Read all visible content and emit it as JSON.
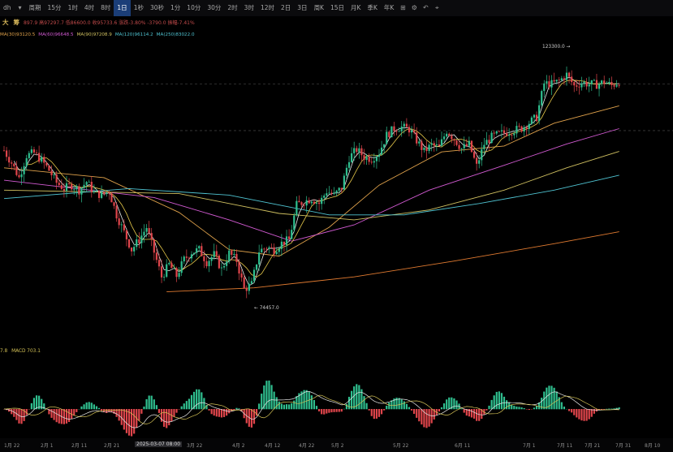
{
  "toolbar": {
    "symbol": "dh",
    "period_label": "周期",
    "intervals": [
      "15分",
      "1时",
      "4时",
      "8时",
      "1日",
      "1秒",
      "30秒",
      "1分",
      "10分",
      "30分",
      "2时",
      "3时",
      "12时",
      "2日",
      "3日",
      "周K",
      "15日",
      "月K",
      "季K",
      "年K"
    ],
    "active_interval": "1日"
  },
  "drawing": {
    "buttons": [
      "大",
      "筹"
    ],
    "ohlc_text": "897.9  高97297.7  低86600.0  收95733.6  涨跌-3.80%  -3790.0  振幅-7.41%"
  },
  "ma_legend": [
    {
      "label": "MA(30)93120.5",
      "color": "#e0a24b"
    },
    {
      "label": "MA(60)96648.5",
      "color": "#d25ad2"
    },
    {
      "label": "MA(90)97208.9",
      "color": "#d0c060"
    },
    {
      "label": "MA(120)96114.2",
      "color": "#4fc3d1"
    },
    {
      "label": "MA(250)83022.0",
      "color": "#4fc3d1"
    }
  ],
  "price_annotations": {
    "high": "123300.0",
    "low": "74457.0"
  },
  "macd": {
    "label_prefix": "7.8",
    "label": "MACD 703.1"
  },
  "xaxis": {
    "labels": [
      "1月 22",
      "2月 1",
      "2月 11",
      "2月 21",
      "2025-03-07 08:00",
      "3月 22",
      "4月 2",
      "4月 12",
      "4月 22",
      "5月 2",
      "5月 22",
      "6月 11",
      "7月 1",
      "7月 11",
      "7月 21",
      "7月 31",
      "8月 10"
    ],
    "highlighted": "2025-03-07 08:00"
  },
  "chart_data": {
    "type": "candlestick",
    "title": "",
    "x_start": "2025-01-17",
    "x_end": "2025-07-31",
    "visible_price_extremes": {
      "high": 123300.0,
      "low": 74457.0
    },
    "moving_averages": [
      "MA(30)",
      "MA(60)",
      "MA(90)",
      "MA(120)",
      "MA(250)"
    ],
    "grid": false,
    "close_path": [
      [
        0,
        104500
      ],
      [
        3,
        102000
      ],
      [
        6,
        99000
      ],
      [
        9,
        103500
      ],
      [
        12,
        104000
      ],
      [
        15,
        102500
      ],
      [
        18,
        100500
      ],
      [
        21,
        98000
      ],
      [
        24,
        96800
      ],
      [
        27,
        97500
      ],
      [
        30,
        96500
      ],
      [
        33,
        98200
      ],
      [
        36,
        96000
      ],
      [
        39,
        95500
      ],
      [
        42,
        96300
      ],
      [
        45,
        91500
      ],
      [
        48,
        88000
      ],
      [
        51,
        84500
      ],
      [
        54,
        86500
      ],
      [
        57,
        89000
      ],
      [
        60,
        84000
      ],
      [
        63,
        79000
      ],
      [
        66,
        81500
      ],
      [
        69,
        79200
      ],
      [
        72,
        82500
      ],
      [
        75,
        84000
      ],
      [
        78,
        84500
      ],
      [
        81,
        82000
      ],
      [
        84,
        83500
      ],
      [
        87,
        80500
      ],
      [
        90,
        83800
      ],
      [
        93,
        82300
      ],
      [
        96,
        76500
      ],
      [
        99,
        77500
      ],
      [
        102,
        84200
      ],
      [
        105,
        85000
      ],
      [
        108,
        84500
      ],
      [
        111,
        85800
      ],
      [
        114,
        86500
      ],
      [
        117,
        93500
      ],
      [
        120,
        94200
      ],
      [
        123,
        94800
      ],
      [
        126,
        93800
      ],
      [
        129,
        96300
      ],
      [
        132,
        95500
      ],
      [
        135,
        97000
      ],
      [
        138,
        103000
      ],
      [
        141,
        104700
      ],
      [
        144,
        103200
      ],
      [
        147,
        102800
      ],
      [
        150,
        104100
      ],
      [
        153,
        107600
      ],
      [
        156,
        108900
      ],
      [
        159,
        109200
      ],
      [
        162,
        108800
      ],
      [
        165,
        106500
      ],
      [
        168,
        104300
      ],
      [
        171,
        105600
      ],
      [
        174,
        105100
      ],
      [
        177,
        108500
      ],
      [
        180,
        106800
      ],
      [
        183,
        104900
      ],
      [
        186,
        105700
      ],
      [
        189,
        101300
      ],
      [
        192,
        105800
      ],
      [
        195,
        107200
      ],
      [
        198,
        107800
      ],
      [
        201,
        108200
      ],
      [
        204,
        108600
      ],
      [
        207,
        109000
      ],
      [
        210,
        110100
      ],
      [
        213,
        111200
      ],
      [
        216,
        118000
      ],
      [
        219,
        117900
      ],
      [
        222,
        118500
      ],
      [
        225,
        119800
      ],
      [
        228,
        117500
      ],
      [
        231,
        118200
      ],
      [
        234,
        117900
      ],
      [
        237,
        117800
      ],
      [
        240,
        118300
      ],
      [
        243,
        117600
      ],
      [
        246,
        118400
      ]
    ],
    "ma_paths": {
      "MA(30)": [
        [
          0,
          101000
        ],
        [
          40,
          99000
        ],
        [
          70,
          92000
        ],
        [
          90,
          84500
        ],
        [
          110,
          83200
        ],
        [
          130,
          89000
        ],
        [
          150,
          97500
        ],
        [
          175,
          104200
        ],
        [
          200,
          105400
        ],
        [
          220,
          110000
        ],
        [
          246,
          113500
        ]
      ],
      "MA(60)": [
        [
          0,
          98500
        ],
        [
          60,
          95000
        ],
        [
          90,
          90500
        ],
        [
          115,
          86200
        ],
        [
          140,
          89500
        ],
        [
          170,
          96500
        ],
        [
          200,
          101500
        ],
        [
          225,
          105800
        ],
        [
          246,
          108900
        ]
      ],
      "MA(90)": [
        [
          0,
          96500
        ],
        [
          70,
          95800
        ],
        [
          110,
          91800
        ],
        [
          140,
          90500
        ],
        [
          170,
          92500
        ],
        [
          200,
          96500
        ],
        [
          225,
          101000
        ],
        [
          246,
          104300
        ]
      ],
      "MA(120)": [
        [
          0,
          94800
        ],
        [
          50,
          96800
        ],
        [
          90,
          95500
        ],
        [
          130,
          91500
        ],
        [
          160,
          91500
        ],
        [
          190,
          93800
        ],
        [
          220,
          96500
        ],
        [
          246,
          99500
        ]
      ],
      "MA(250)": [
        [
          65,
          76000
        ],
        [
          100,
          76800
        ],
        [
          140,
          79000
        ],
        [
          180,
          82200
        ],
        [
          220,
          85700
        ],
        [
          246,
          88100
        ]
      ]
    }
  }
}
